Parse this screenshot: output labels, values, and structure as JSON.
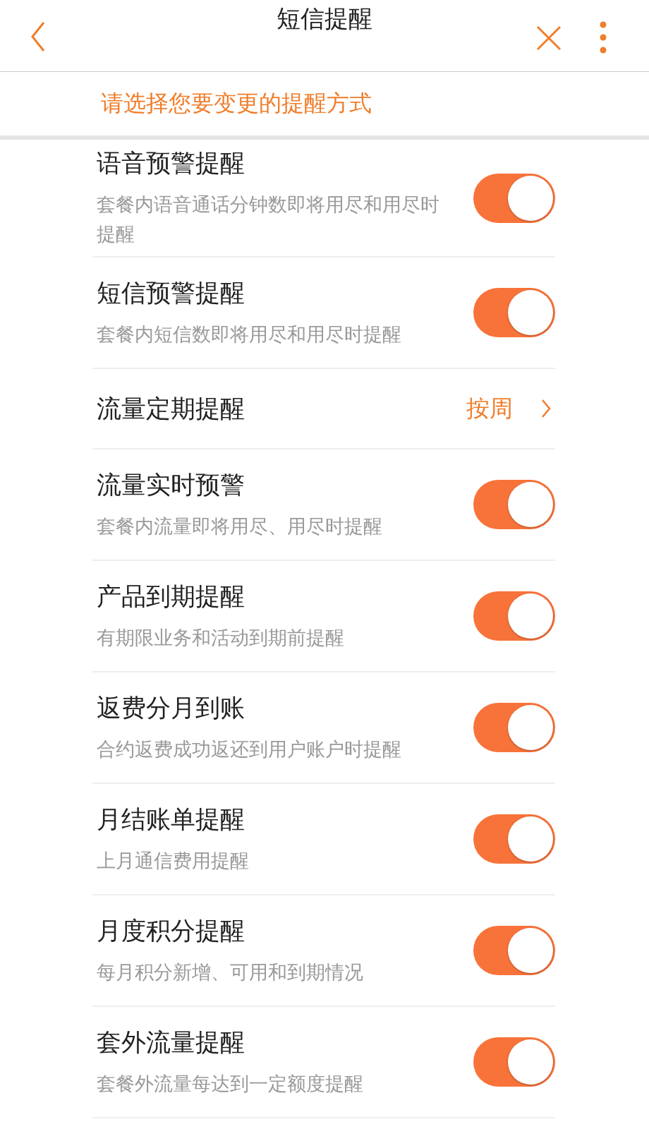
{
  "header": {
    "title": "短信提醒"
  },
  "prompt": "请选择您要变更的提醒方式",
  "items": [
    {
      "kind": "toggle",
      "title": "语音预警提醒",
      "desc": "套餐内语音通话分钟数即将用尽和用尽时提醒",
      "on": true
    },
    {
      "kind": "toggle",
      "title": "短信预警提醒",
      "desc": "套餐内短信数即将用尽和用尽时提醒",
      "on": true
    },
    {
      "kind": "link",
      "title": "流量定期提醒",
      "value": "按周"
    },
    {
      "kind": "toggle",
      "title": "流量实时预警",
      "desc": "套餐内流量即将用尽、用尽时提醒",
      "on": true
    },
    {
      "kind": "toggle",
      "title": "产品到期提醒",
      "desc": "有期限业务和活动到期前提醒",
      "on": true
    },
    {
      "kind": "toggle",
      "title": "返费分月到账",
      "desc": "合约返费成功返还到用户账户时提醒",
      "on": true
    },
    {
      "kind": "toggle",
      "title": "月结账单提醒",
      "desc": "上月通信费用提醒",
      "on": true
    },
    {
      "kind": "toggle",
      "title": "月度积分提醒",
      "desc": "每月积分新增、可用和到期情况",
      "on": true
    },
    {
      "kind": "toggle",
      "title": "套外流量提醒",
      "desc": "套餐外流量每达到一定额度提醒",
      "on": true
    }
  ]
}
